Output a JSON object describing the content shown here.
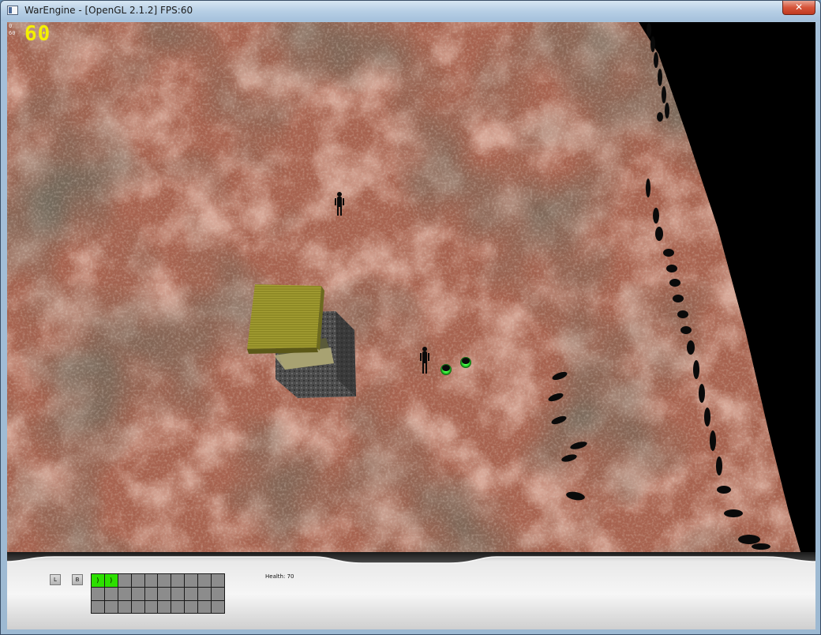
{
  "window": {
    "title": "WarEngine - [OpenGL 2.1.2] FPS:60",
    "close_glyph": "✕",
    "icon": "app-window-icon"
  },
  "overlay": {
    "debug_line1": "0",
    "debug_line2": "60",
    "fps": "60",
    "fps_color": "#f4f000"
  },
  "hud": {
    "buttons": [
      {
        "label": "L"
      },
      {
        "label": "B"
      }
    ],
    "health_text": "Health: 70",
    "inventory": {
      "rows": 3,
      "cols": 10,
      "filled_color": "#2ce000",
      "empty_color": "#8c8c8c",
      "slots": [
        {
          "filled": true,
          "glyph": ")"
        },
        {
          "filled": true,
          "glyph": ")"
        }
      ]
    }
  },
  "colors": {
    "terrain": "#b86a52",
    "void": "#000000",
    "building_roof": "#8f8a26",
    "building_wall": "#4a4a4a",
    "unit": "#0a0a0a",
    "selected_unit_glow": "#3cff3c"
  }
}
